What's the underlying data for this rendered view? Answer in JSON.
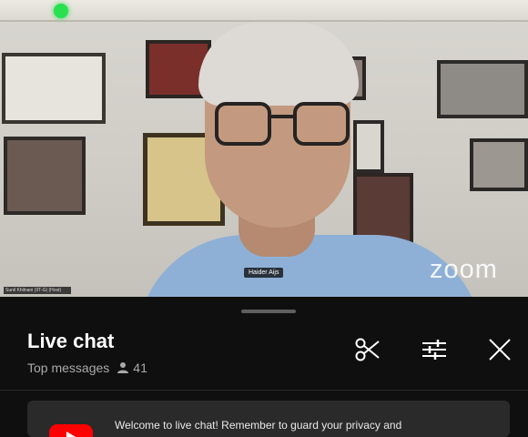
{
  "video": {
    "participant_name": "Haider Aijs",
    "self_view_label": "Sunil Khilnani (IIT-G) (Host)",
    "watermark": "zoom"
  },
  "chat": {
    "title": "Live chat",
    "mode_label": "Top messages",
    "viewer_count": "41",
    "welcome_message": "Welcome to live chat! Remember to guard your privacy and",
    "icons": {
      "viewers": "person-icon",
      "scissors": "scissors-icon",
      "filter": "sliders-icon",
      "close": "close-icon",
      "logo": "youtube-logo-icon"
    },
    "colors": {
      "background": "#0f0f0f",
      "text": "#ffffff",
      "secondary_text": "#aaaaaa",
      "card": "#2a2a2a",
      "brand_red": "#ff0000"
    }
  }
}
